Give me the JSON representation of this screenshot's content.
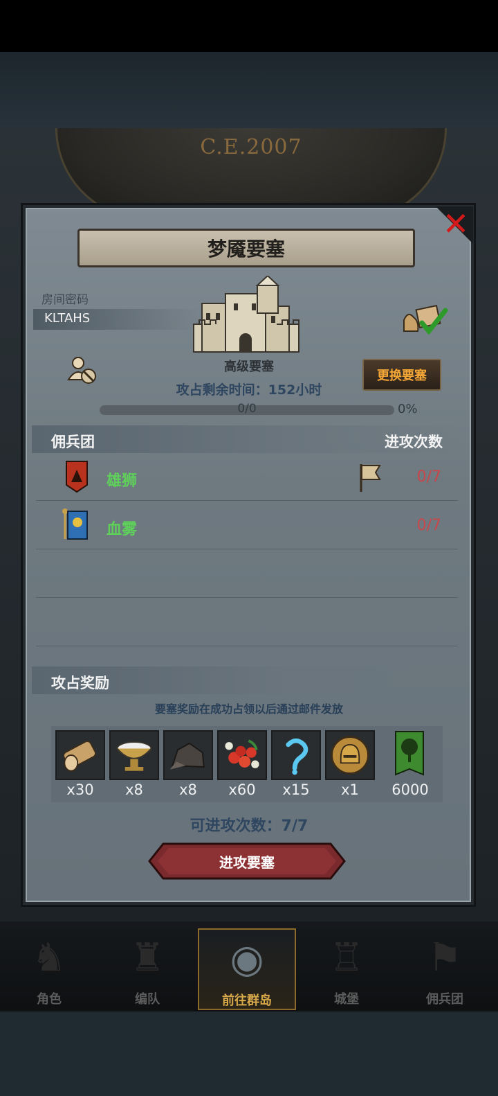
{
  "header": {
    "era_label": "C.E.2007"
  },
  "dialog": {
    "title": "梦魇要塞",
    "close_icon": "close-icon",
    "room": {
      "label": "房间密码",
      "code": "KLTAHS"
    },
    "fortress": {
      "grade": "高级要塞",
      "change_button": "更换要塞"
    },
    "time_remaining": "攻占剩余时间：152小时",
    "progress": {
      "text": "0/0",
      "percent_text": "0%",
      "value": 0
    },
    "mercenary_section": {
      "title": "佣兵团",
      "count_header": "进攻次数",
      "rows": [
        {
          "name": "雄狮",
          "count": "0/7",
          "banner_color": "#b8321e",
          "flag": true
        },
        {
          "name": "血雾",
          "count": "0/7",
          "banner_color": "#2f6fb3",
          "flag": false
        }
      ]
    },
    "reward_section": {
      "title": "攻占奖励",
      "note": "要塞奖励在成功占领以后通过邮件发放",
      "items": [
        {
          "icon": "wood-log-icon",
          "qty": "x30"
        },
        {
          "icon": "bowl-icon",
          "qty": "x8"
        },
        {
          "icon": "ore-rock-icon",
          "qty": "x8"
        },
        {
          "icon": "berries-icon",
          "qty": "x60"
        },
        {
          "icon": "blue-hook-icon",
          "qty": "x15"
        },
        {
          "icon": "knight-helmet-icon",
          "qty": "x1"
        },
        {
          "icon": "green-tree-banner-icon",
          "qty": "6000"
        }
      ]
    },
    "attempts": "可进攻次数：7/7",
    "attack_button": "进攻要塞"
  },
  "bottom_nav": [
    {
      "label": "角色",
      "icon": "character-icon",
      "active": false
    },
    {
      "label": "编队",
      "icon": "formation-icon",
      "active": false
    },
    {
      "label": "前往群岛",
      "icon": "islands-icon",
      "active": true
    },
    {
      "label": "城堡",
      "icon": "castle-icon",
      "active": false
    },
    {
      "label": "佣兵团",
      "icon": "mercenary-icon",
      "active": false
    }
  ]
}
